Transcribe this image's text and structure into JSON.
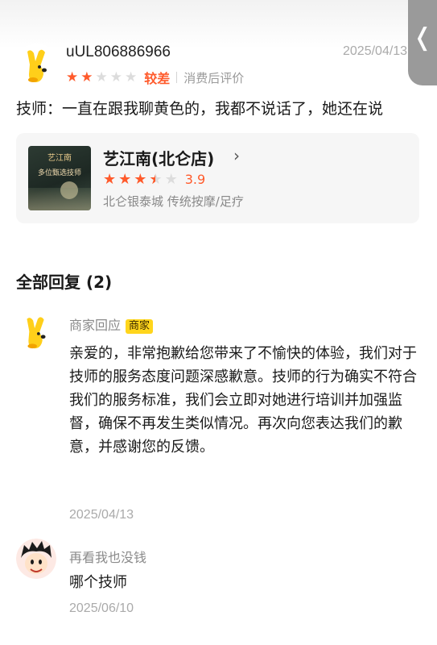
{
  "review": {
    "username": "uUL806886966",
    "date": "2025/04/13",
    "stars_filled": 2,
    "stars_total": 5,
    "rating_word": "较差",
    "rating_note": "消费后评价",
    "text": "技师：一直在跟我聊黄色的，我都不说话了，她还在说"
  },
  "shop": {
    "name": "艺江南(北仑店)",
    "thumb_title": "艺江南",
    "thumb_sub": "多位甄选技师",
    "rating": 3.5,
    "score": "3.9",
    "meta": "北仑银泰城 传统按摩/足疗"
  },
  "replies": {
    "title": "全部回复 (2)",
    "items": [
      {
        "name": "商家回应",
        "badge": "商家",
        "body": "亲爱的，非常抱歉给您带来了不愉快的体验，我们对于技师的服务态度问题深感歉意。技师的行为确实不符合我们的服务标准，我们会立即对她进行培训并加强监督，确保不再发生类似情况。再次向您表达我们的歉意，并感谢您的反馈。",
        "date": "2025/04/13"
      },
      {
        "name": "再看我也没钱",
        "body": "哪个技师",
        "date": "2025/06/10"
      }
    ]
  },
  "ui": {
    "side_tab_glyph": "❬",
    "chevron": "›",
    "star_glyph": "★"
  },
  "colors": {
    "accent": "#ff5a2b",
    "badge": "#ffd51c",
    "card_bg": "#f6f6f6"
  }
}
